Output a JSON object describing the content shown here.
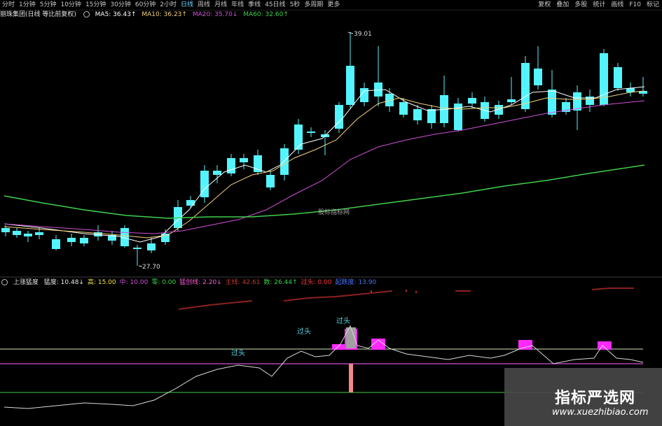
{
  "toolbar": {
    "periods": [
      "分时",
      "1分钟",
      "5分钟",
      "10分钟",
      "15分钟",
      "30分钟",
      "60分钟",
      "2小时",
      "日线",
      "周线",
      "月线",
      "年线",
      "季线",
      "45日线",
      "5秒",
      "多周期",
      "更多"
    ],
    "active": "日线",
    "right": [
      "复权",
      "叠加",
      "多股",
      "统计",
      "画线",
      "F10",
      "标记"
    ]
  },
  "main_legend": {
    "stock": "丽珠集团(日线 等比前复权)",
    "ma5": {
      "label": "MA5: 36.43↑",
      "color": "#ffffff"
    },
    "ma10": {
      "label": "MA10: 36.23↑",
      "color": "#f2d27a"
    },
    "ma20": {
      "label": "MA20: 35.70↓",
      "color": "#d050d8"
    },
    "ma60": {
      "label": "MA60: 32.60↑",
      "color": "#3fd04a"
    }
  },
  "indicator_legend": {
    "name": "上涨猛度",
    "items": [
      {
        "label": "猛度: 10.48↓",
        "color": "#e6e6e6"
      },
      {
        "label": "高: 15.00",
        "color": "#f2e24a"
      },
      {
        "label": "中: 10.00",
        "color": "#d050d8"
      },
      {
        "label": "零: 0.00",
        "color": "#3fd04a"
      },
      {
        "label": "猛创线: 2.20↓",
        "color": "#ff5ad8"
      },
      {
        "label": "主线: 42.61",
        "color": "#c0392b"
      },
      {
        "label": "数: 26.44↑",
        "color": "#3fd04a"
      },
      {
        "label": "过头: 0.00",
        "color": "#ff3b3b"
      },
      {
        "label": "起跌度: 13.90",
        "color": "#4a74ff"
      }
    ]
  },
  "chart_data": {
    "type": "candlestick",
    "annotations": {
      "high_label": "39.01",
      "low_label": "27.70",
      "center_text": "股标指标网",
      "indicator_labels": [
        "过头",
        "过头",
        "过头"
      ]
    },
    "high_price": 39.01,
    "low_price": 27.7,
    "current": {
      "ma5": 36.43,
      "ma10": 36.23,
      "ma20": 35.7,
      "ma60": 32.6
    },
    "colors": {
      "up": "#ff4a4a",
      "down": "#54f4ff",
      "ma5": "#ffffff",
      "ma10": "#f2d27a",
      "ma20": "#d050d8",
      "ma60": "#3fd04a"
    },
    "indicator_levels": {
      "high": 15.0,
      "mid": 10.0,
      "zero": 0.0
    },
    "indicator_current": 10.48
  },
  "watermark": {
    "title": "指标严选网",
    "url": "www.xuezhibiao.com"
  }
}
